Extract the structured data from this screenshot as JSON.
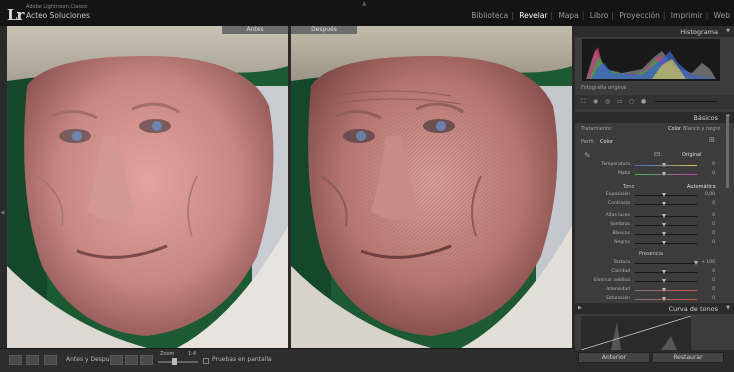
{
  "app": {
    "logo": "Lr",
    "sub_title": "Adobe Lightroom Classic",
    "user_name": "Acteo Soluciones"
  },
  "modules": [
    "Biblioteca",
    "Revelar",
    "Mapa",
    "Libro",
    "Proyección",
    "Imprimir",
    "Web"
  ],
  "active_module": "Revelar",
  "views": {
    "before_label": "Antes",
    "after_label": "Después"
  },
  "toolbar": {
    "before_after_label": "Antes y Después:",
    "zoom_label": "Zoom",
    "zoom_value": "1:4",
    "proof_label": "Pruebas en pantalla"
  },
  "panels": {
    "histogram_title": "Histograma",
    "original_photo_label": "Fotografía original",
    "basics_title": "Básicos",
    "treatment_label": "Tratamiento:",
    "treatment_color": "Color",
    "treatment_bw": "Blanco y negro",
    "profile_label": "Perfil:",
    "profile_value": "Color",
    "wb_label": "EB:",
    "wb_value": "Original",
    "tone_label": "Tono",
    "tone_auto": "Automático",
    "presence_label": "Presencia",
    "tone_curve_title": "Curva de tonos",
    "previous_button": "Anterior",
    "reset_button": "Restaurar"
  },
  "sliders": {
    "wb": [
      {
        "label": "Temperatura",
        "value": "0"
      },
      {
        "label": "Matiz",
        "value": "0"
      }
    ],
    "tone": [
      {
        "label": "Exposición",
        "value": "0,00"
      },
      {
        "label": "Contraste",
        "value": "0"
      },
      {
        "label": "Altas luces",
        "value": "0"
      },
      {
        "label": "Sombras",
        "value": "0"
      },
      {
        "label": "Blancos",
        "value": "0"
      },
      {
        "label": "Negros",
        "value": "0"
      }
    ],
    "presence": [
      {
        "label": "Textura",
        "value": "+ 100"
      },
      {
        "label": "Claridad",
        "value": "0"
      },
      {
        "label": "Eliminar neblina",
        "value": "0"
      },
      {
        "label": "Intensidad",
        "value": "0"
      },
      {
        "label": "Saturación",
        "value": "0"
      }
    ]
  },
  "icons": [
    "navigator-triangle",
    "crop-icon",
    "spot-removal-icon",
    "red-eye-icon",
    "graduated-filter-icon",
    "radial-filter-icon",
    "brush-icon",
    "eyedropper-icon",
    "view-grid-icon"
  ]
}
